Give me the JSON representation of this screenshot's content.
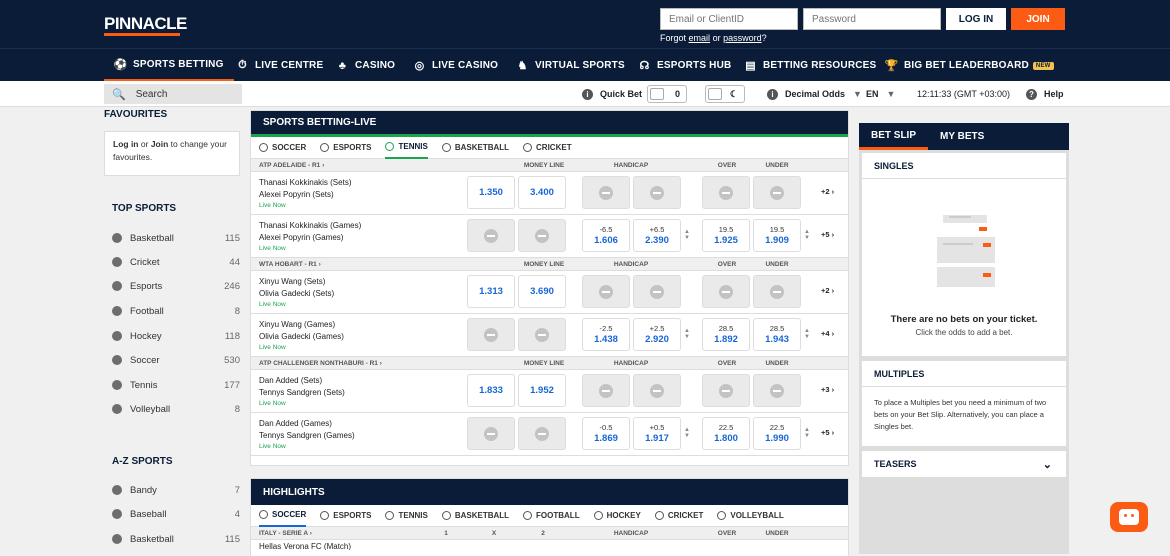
{
  "header": {
    "logo": "PINNACLE",
    "email_placeholder": "Email or ClientID",
    "password_placeholder": "Password",
    "login": "LOG IN",
    "join": "JOIN",
    "forgot_prefix": "Forgot",
    "forgot_email": "email",
    "forgot_or": "or",
    "forgot_password": "password",
    "forgot_suffix": "?"
  },
  "nav": [
    {
      "label": "SPORTS BETTING",
      "icon": "soccer-ball-icon"
    },
    {
      "label": "LIVE CENTRE",
      "icon": "stopwatch-icon"
    },
    {
      "label": "CASINO",
      "icon": "chips-icon"
    },
    {
      "label": "LIVE CASINO",
      "icon": "roulette-icon"
    },
    {
      "label": "VIRTUAL SPORTS",
      "icon": "horse-icon"
    },
    {
      "label": "ESPORTS HUB",
      "icon": "headset-icon"
    },
    {
      "label": "BETTING RESOURCES",
      "icon": "book-icon"
    },
    {
      "label": "BIG BET LEADERBOARD",
      "icon": "trophy-icon",
      "badge": "NEW"
    }
  ],
  "subbar": {
    "search_placeholder": "Search",
    "quick_bet": "Quick Bet",
    "quick_bet_value": "0",
    "odds_format": "Decimal Odds",
    "language": "EN",
    "time": "12:11:33 (GMT +03:00)",
    "help": "Help"
  },
  "sidebar": {
    "favourites_title": "FAVOURITES",
    "fav_login": "Log in",
    "fav_or": "or",
    "fav_join": "Join",
    "fav_text": "to change your favourites.",
    "top_sports_title": "TOP SPORTS",
    "top_sports": [
      {
        "name": "Basketball",
        "count": "115"
      },
      {
        "name": "Cricket",
        "count": "44"
      },
      {
        "name": "Esports",
        "count": "246"
      },
      {
        "name": "Football",
        "count": "8"
      },
      {
        "name": "Hockey",
        "count": "118"
      },
      {
        "name": "Soccer",
        "count": "530"
      },
      {
        "name": "Tennis",
        "count": "177"
      },
      {
        "name": "Volleyball",
        "count": "8"
      }
    ],
    "az_title": "A-Z SPORTS",
    "az_sports": [
      {
        "name": "Bandy",
        "count": "7"
      },
      {
        "name": "Baseball",
        "count": "4"
      },
      {
        "name": "Basketball",
        "count": "115"
      }
    ]
  },
  "live": {
    "title": "SPORTS BETTING-LIVE",
    "tabs": [
      "SOCCER",
      "ESPORTS",
      "TENNIS",
      "BASKETBALL",
      "CRICKET"
    ],
    "col_moneyline": "MONEY LINE",
    "col_handicap": "HANDICAP",
    "col_over": "OVER",
    "col_under": "UNDER",
    "leagues": [
      {
        "name": "ATP ADELAIDE - R1",
        "matches": [
          {
            "t1": "Thanasi Kokkinakis (Sets)",
            "t2": "Alexei Popyrin (Sets)",
            "live": "Live Now",
            "ml1": "1.350",
            "ml2": "3.400",
            "more": "+2"
          },
          {
            "t1": "Thanasi Kokkinakis (Games)",
            "t2": "Alexei Popyrin (Games)",
            "live": "Live Now",
            "h1p": "-6.5",
            "h1": "1.606",
            "h2p": "+6.5",
            "h2": "2.390",
            "op": "19.5",
            "o": "1.925",
            "up": "19.5",
            "u": "1.909",
            "more": "+5"
          }
        ]
      },
      {
        "name": "WTA HOBART - R1",
        "matches": [
          {
            "t1": "Xinyu Wang (Sets)",
            "t2": "Olivia Gadecki (Sets)",
            "live": "Live Now",
            "ml1": "1.313",
            "ml2": "3.690",
            "more": "+2"
          },
          {
            "t1": "Xinyu Wang (Games)",
            "t2": "Olivia Gadecki (Games)",
            "live": "Live Now",
            "h1p": "-2.5",
            "h1": "1.438",
            "h2p": "+2.5",
            "h2": "2.920",
            "op": "28.5",
            "o": "1.892",
            "up": "28.5",
            "u": "1.943",
            "more": "+4"
          }
        ]
      },
      {
        "name": "ATP CHALLENGER NONTHABURI - R1",
        "matches": [
          {
            "t1": "Dan Added (Sets)",
            "t2": "Tennys Sandgren (Sets)",
            "live": "Live Now",
            "ml1": "1.833",
            "ml2": "1.952",
            "more": "+3"
          },
          {
            "t1": "Dan Added (Games)",
            "t2": "Tennys Sandgren (Games)",
            "live": "Live Now",
            "h1p": "-0.5",
            "h1": "1.869",
            "h2p": "+0.5",
            "h2": "1.917",
            "op": "22.5",
            "o": "1.800",
            "up": "22.5",
            "u": "1.990",
            "more": "+5"
          }
        ]
      }
    ]
  },
  "highlights": {
    "title": "HIGHLIGHTS",
    "tabs": [
      "SOCCER",
      "ESPORTS",
      "TENNIS",
      "BASKETBALL",
      "FOOTBALL",
      "HOCKEY",
      "CRICKET",
      "VOLLEYBALL"
    ],
    "league": "ITALY - SERIE A",
    "col1": "1",
    "colx": "X",
    "col2": "2",
    "col_handicap": "HANDICAP",
    "col_over": "OVER",
    "col_under": "UNDER",
    "partial_row": "Hellas Verona FC (Match)"
  },
  "betslip": {
    "tab_betslip": "BET SLIP",
    "tab_mybets": "MY BETS",
    "singles": "SINGLES",
    "empty_title": "There are no bets on your ticket.",
    "empty_sub": "Click the odds to add a bet.",
    "multiples": "MULTIPLES",
    "multiples_text": "To place a Multiples bet you need a minimum of two bets on your Bet Slip. Alternatively, you can place a Singles bet.",
    "teasers": "TEASERS"
  },
  "colors": {
    "navy": "#0a1c37",
    "orange": "#fb5b13",
    "green": "#1ba34e",
    "odds_blue": "#1866d6"
  }
}
